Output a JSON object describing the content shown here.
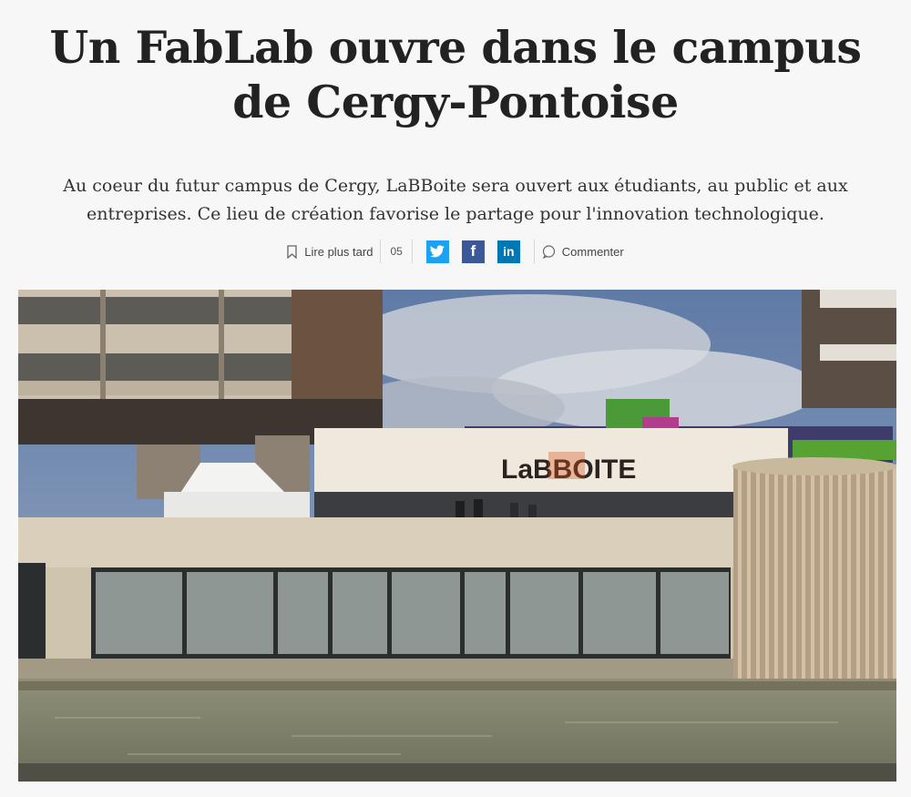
{
  "article": {
    "title": "Un FabLab ouvre dans le campus de Cergy-Pontoise",
    "chapo": "Au coeur du futur campus de Cergy, LaBBoite sera ouvert aux étudiants, au public et aux entreprises. Ce lieu de création favorise le partage pour l'innovation technologique."
  },
  "toolbar": {
    "read_later": "Lire plus tard",
    "share_count": "05",
    "twitter_icon": "twitter-icon",
    "facebook_icon": "facebook-icon",
    "linkedin_icon": "linkedin-icon",
    "comment": "Commenter"
  },
  "photo": {
    "sign_text": "LaBBOITE"
  },
  "colors": {
    "twitter": "#1da1f2",
    "facebook": "#3b5998",
    "linkedin": "#0077b5",
    "sign_orange": "#d9531e"
  }
}
